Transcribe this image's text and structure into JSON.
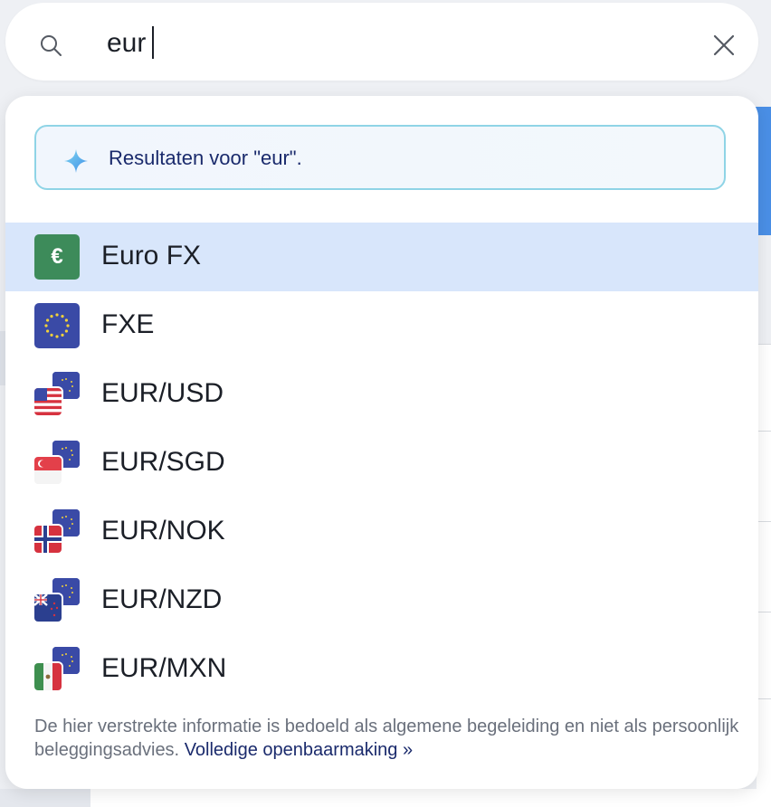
{
  "search": {
    "value": "eur",
    "search_icon": "search-icon",
    "clear_icon": "close-icon"
  },
  "banner": {
    "text": "Resultaten voor \"eur\".",
    "icon": "sparkle-icon"
  },
  "results": [
    {
      "label": "Euro FX",
      "icon": "euro-sign-icon",
      "selected": true
    },
    {
      "label": "FXE",
      "icon": "eu-flag-icon",
      "selected": false
    },
    {
      "label": "EUR/USD",
      "icon": "eur-usd-pair-icon",
      "selected": false
    },
    {
      "label": "EUR/SGD",
      "icon": "eur-sgd-pair-icon",
      "selected": false
    },
    {
      "label": "EUR/NOK",
      "icon": "eur-nok-pair-icon",
      "selected": false
    },
    {
      "label": "EUR/NZD",
      "icon": "eur-nzd-pair-icon",
      "selected": false
    },
    {
      "label": "EUR/MXN",
      "icon": "eur-mxn-pair-icon",
      "selected": false
    }
  ],
  "euro_glyph": "€",
  "disclaimer": {
    "text": "De hier verstrekte informatie is bedoeld als algemene begeleiding en niet als persoonlijk beleggingsadvies. ",
    "link": "Volledige openbaarmaking »"
  },
  "colors": {
    "selected_row": "#d8e6fb",
    "link": "#1a2a6c",
    "banner_border": "#8fd4e6",
    "eu_blue": "#3a4aa6",
    "euro_green": "#3d8b5a"
  }
}
